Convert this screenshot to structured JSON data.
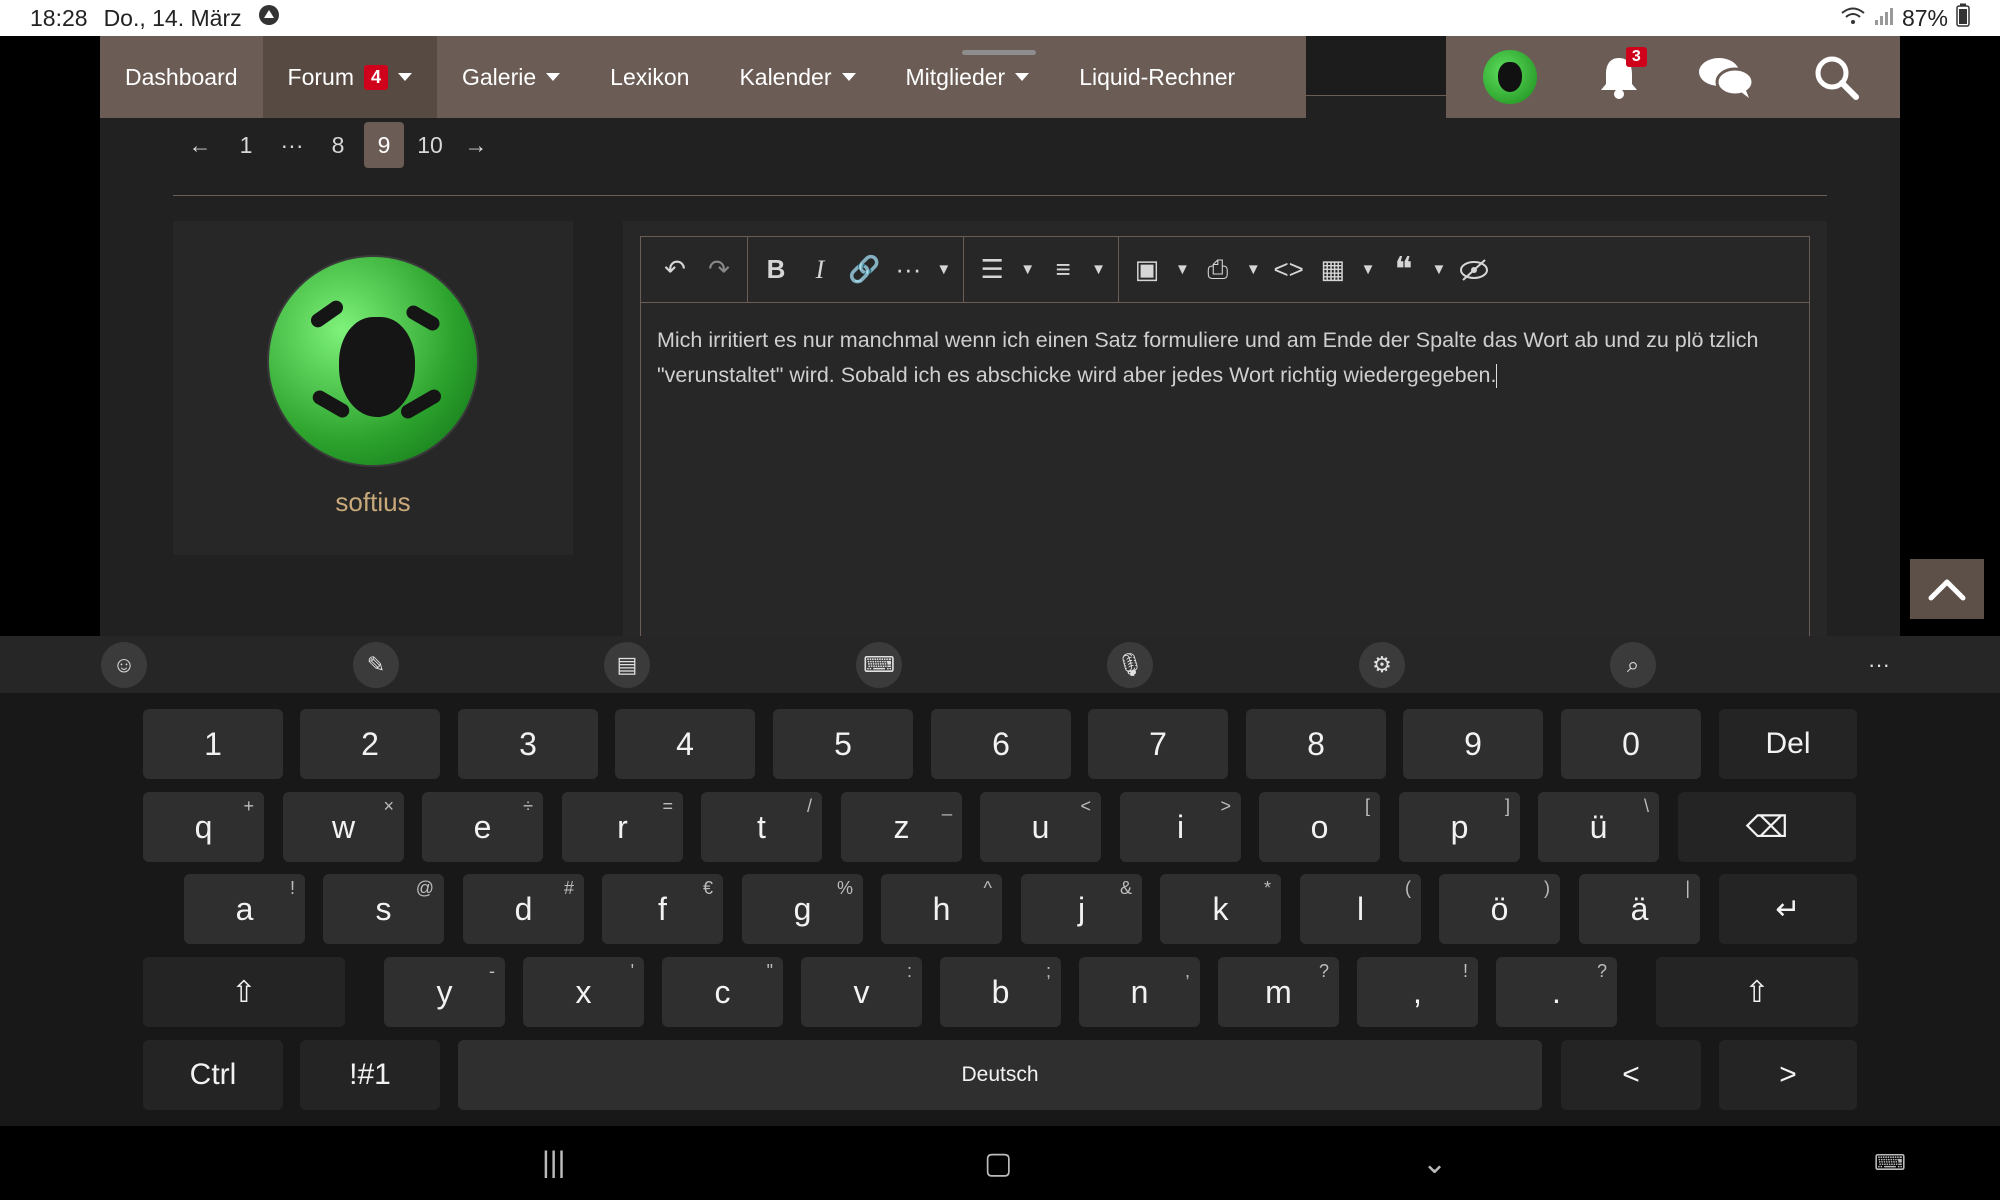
{
  "status_bar": {
    "time": "18:28",
    "date": "Do., 14. März",
    "battery": "87%"
  },
  "nav": {
    "items": [
      {
        "label": "Dashboard",
        "dropdown": false,
        "badge": ""
      },
      {
        "label": "Forum",
        "dropdown": true,
        "badge": "4"
      },
      {
        "label": "Galerie",
        "dropdown": true,
        "badge": ""
      },
      {
        "label": "Lexikon",
        "dropdown": false,
        "badge": ""
      },
      {
        "label": "Kalender",
        "dropdown": true,
        "badge": ""
      },
      {
        "label": "Mitglieder",
        "dropdown": true,
        "badge": ""
      },
      {
        "label": "Liquid-Rechner",
        "dropdown": false,
        "badge": ""
      }
    ],
    "notification_count": "3"
  },
  "pagination": {
    "prev": "←",
    "pages": [
      "1",
      "···",
      "8",
      "9",
      "10"
    ],
    "current": "9",
    "next": "→"
  },
  "post": {
    "username": "softius"
  },
  "editor": {
    "text": "Mich irritiert es nur manchmal wenn ich einen Satz formuliere und am Ende der Spalte das Wort ab und zu plö tzlich \"verunstaltet\" wird. Sobald ich es abschicke wird aber jedes Wort richtig wiedergegeben."
  },
  "keyboard": {
    "rows": [
      [
        {
          "k": "1"
        },
        {
          "k": "2"
        },
        {
          "k": "3"
        },
        {
          "k": "4"
        },
        {
          "k": "5"
        },
        {
          "k": "6"
        },
        {
          "k": "7"
        },
        {
          "k": "8"
        },
        {
          "k": "9"
        },
        {
          "k": "0"
        },
        {
          "k": "Del"
        }
      ],
      [
        {
          "k": "q",
          "s": "+"
        },
        {
          "k": "w",
          "s": "×"
        },
        {
          "k": "e",
          "s": "÷"
        },
        {
          "k": "r",
          "s": "="
        },
        {
          "k": "t",
          "s": "/"
        },
        {
          "k": "z",
          "s": "_"
        },
        {
          "k": "u",
          "s": "<"
        },
        {
          "k": "i",
          "s": ">"
        },
        {
          "k": "o",
          "s": "["
        },
        {
          "k": "p",
          "s": "]"
        },
        {
          "k": "ü",
          "s": "\\"
        },
        {
          "k": "⌫"
        }
      ],
      [
        {
          "k": "a",
          "s": "!"
        },
        {
          "k": "s",
          "s": "@"
        },
        {
          "k": "d",
          "s": "#"
        },
        {
          "k": "f",
          "s": "€"
        },
        {
          "k": "g",
          "s": "%"
        },
        {
          "k": "h",
          "s": "^"
        },
        {
          "k": "j",
          "s": "&"
        },
        {
          "k": "k",
          "s": "*"
        },
        {
          "k": "l",
          "s": "("
        },
        {
          "k": "ö",
          "s": ")"
        },
        {
          "k": "ä",
          "s": "|"
        },
        {
          "k": "↵"
        }
      ],
      [
        {
          "k": "⇧"
        },
        {
          "k": "y",
          "s": "-"
        },
        {
          "k": "x",
          "s": "'"
        },
        {
          "k": "c",
          "s": "\""
        },
        {
          "k": "v",
          "s": ":"
        },
        {
          "k": "b",
          "s": ";"
        },
        {
          "k": "n",
          "s": ","
        },
        {
          "k": "m",
          "s": "?"
        },
        {
          "k": ",",
          "s": "!"
        },
        {
          "k": ".",
          "s": "?"
        },
        {
          "k": "⇧"
        }
      ],
      [
        {
          "k": "Ctrl"
        },
        {
          "k": "!#1"
        },
        {
          "k": "Deutsch"
        },
        {
          "k": "<"
        },
        {
          "k": ">"
        }
      ]
    ]
  },
  "icons": {
    "undo": "undo-icon",
    "redo": "redo-icon",
    "bold": "bold-icon",
    "italic": "italic-icon",
    "link": "link-icon",
    "more": "more-icon",
    "list": "list-icon",
    "align": "align-icon",
    "image": "image-icon",
    "media": "media-icon",
    "code": "code-icon",
    "table": "table-icon",
    "quote": "quote-icon",
    "spoiler": "spoiler-icon"
  },
  "colors": {
    "nav": "#6b5d55",
    "page_bg": "#212121",
    "badge": "#d0021b",
    "username": "#c9a97a"
  }
}
